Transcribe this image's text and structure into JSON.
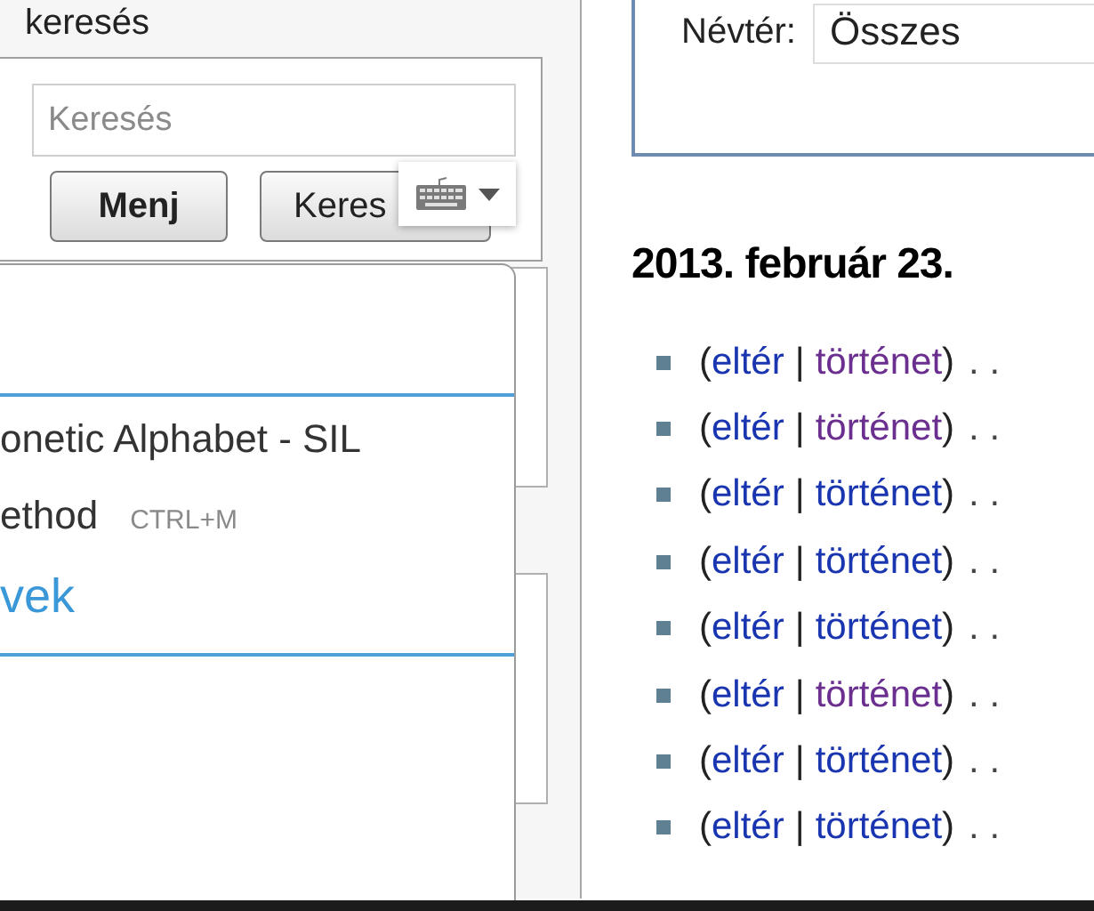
{
  "sidebar": {
    "search_portlet": {
      "title": "keresés",
      "search_field": {
        "placeholder": "Keresés"
      },
      "buttons": [
        {
          "label": "Menj",
          "kind": "go"
        },
        {
          "label": "Keres",
          "kind": "search"
        }
      ]
    }
  },
  "input_menu": {
    "items": [
      {
        "label": "onetic Alphabet - SIL",
        "kind": "option"
      },
      {
        "label": "ethod",
        "shortcut": "CTRL+M",
        "kind": "option"
      },
      {
        "label": "vek",
        "kind": "link"
      }
    ]
  },
  "filter": {
    "namespace_label": "Névtér:",
    "namespace_value": "Összes"
  },
  "date_heading": "2013. február 23.",
  "changes": [
    {
      "open": "(",
      "diff": "eltér",
      "separator": "|",
      "history": "történet",
      "close": ")",
      "history_visited": true,
      "trail": ". ."
    },
    {
      "open": "(",
      "diff": "eltér",
      "separator": "|",
      "history": "történet",
      "close": ")",
      "history_visited": true,
      "trail": ". ."
    },
    {
      "open": "(",
      "diff": "eltér",
      "separator": "|",
      "history": "történet",
      "close": ")",
      "history_visited": false,
      "trail": ". ."
    },
    {
      "open": "(",
      "diff": "eltér",
      "separator": "|",
      "history": "történet",
      "close": ")",
      "history_visited": false,
      "trail": ". ."
    },
    {
      "open": "(",
      "diff": "eltér",
      "separator": "|",
      "history": "történet",
      "close": ")",
      "history_visited": false,
      "trail": ". ."
    },
    {
      "open": "(",
      "diff": "eltér",
      "separator": "|",
      "history": "történet",
      "close": ")",
      "history_visited": true,
      "trail": ". ."
    },
    {
      "open": "(",
      "diff": "eltér",
      "separator": "|",
      "history": "történet",
      "close": ")",
      "history_visited": false,
      "trail": ". ."
    },
    {
      "open": "(",
      "diff": "eltér",
      "separator": "|",
      "history": "történet",
      "close": ")",
      "history_visited": false,
      "trail": ". ."
    }
  ]
}
